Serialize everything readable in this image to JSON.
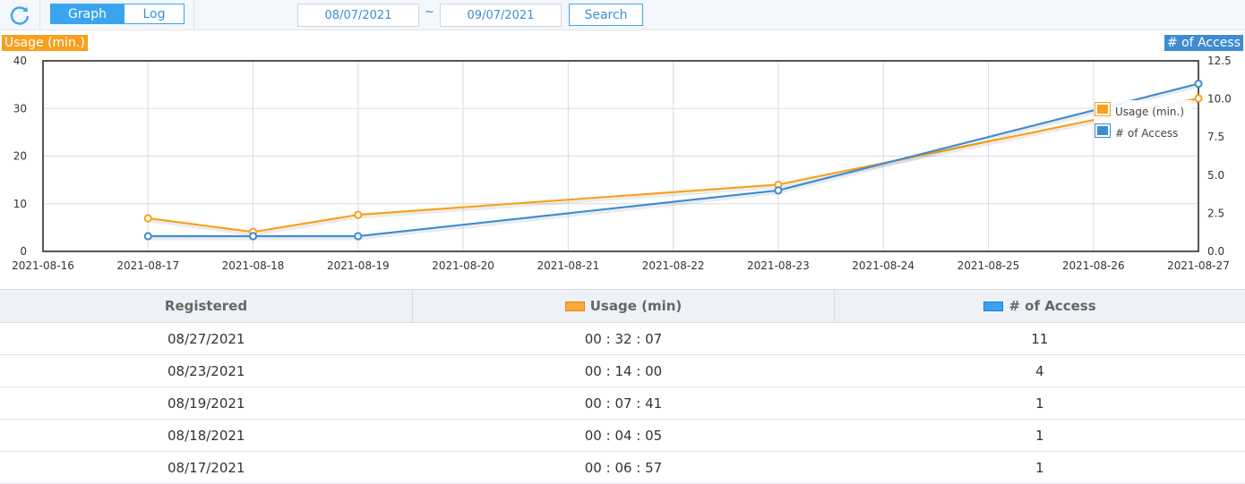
{
  "toolbar": {
    "tabs": [
      {
        "label": "Graph",
        "active": true
      },
      {
        "label": "Log",
        "active": false
      }
    ],
    "date_from": "08/07/2021",
    "date_to": "09/07/2021",
    "separator": "~",
    "search_label": "Search"
  },
  "colors": {
    "usage": "#f7a020",
    "access": "#3f8cd1",
    "accent": "#3aa5ee"
  },
  "chart_data": {
    "type": "line",
    "left_axis_title": "Usage (min.)",
    "right_axis_title": "# of Access",
    "x_ticks": [
      "2021-08-16",
      "2021-08-17",
      "2021-08-18",
      "2021-08-19",
      "2021-08-20",
      "2021-08-21",
      "2021-08-22",
      "2021-08-23",
      "2021-08-24",
      "2021-08-25",
      "2021-08-26",
      "2021-08-27"
    ],
    "y_left_ticks": [
      "0",
      "10",
      "20",
      "30",
      "40"
    ],
    "y_right_ticks": [
      "0.0",
      "2.5",
      "5.0",
      "7.5",
      "10.0",
      "12.5"
    ],
    "y_left_range": [
      0,
      40
    ],
    "y_right_range": [
      0,
      12.5
    ],
    "x_range": [
      "2021-08-16",
      "2021-08-27"
    ],
    "grid": true,
    "legend_position": "top-right",
    "series": [
      {
        "name": "Usage (min.)",
        "axis": "left",
        "color": "#f7a020",
        "x": [
          "2021-08-17",
          "2021-08-18",
          "2021-08-19",
          "2021-08-23",
          "2021-08-27"
        ],
        "values": [
          6.95,
          4.08,
          7.68,
          14.0,
          32.12
        ]
      },
      {
        "name": "# of Access",
        "axis": "right",
        "color": "#3f8cd1",
        "x": [
          "2021-08-17",
          "2021-08-18",
          "2021-08-19",
          "2021-08-23",
          "2021-08-27"
        ],
        "values": [
          1,
          1,
          1,
          4,
          11
        ]
      }
    ]
  },
  "table": {
    "headers": [
      "Registered",
      "Usage (min)",
      "# of Access"
    ],
    "rows": [
      {
        "date": "08/27/2021",
        "usage": "00 : 32 : 07",
        "access": "11"
      },
      {
        "date": "08/23/2021",
        "usage": "00 : 14 : 00",
        "access": "4"
      },
      {
        "date": "08/19/2021",
        "usage": "00 : 07 : 41",
        "access": "1"
      },
      {
        "date": "08/18/2021",
        "usage": "00 : 04 : 05",
        "access": "1"
      },
      {
        "date": "08/17/2021",
        "usage": "00 : 06 : 57",
        "access": "1"
      }
    ]
  }
}
